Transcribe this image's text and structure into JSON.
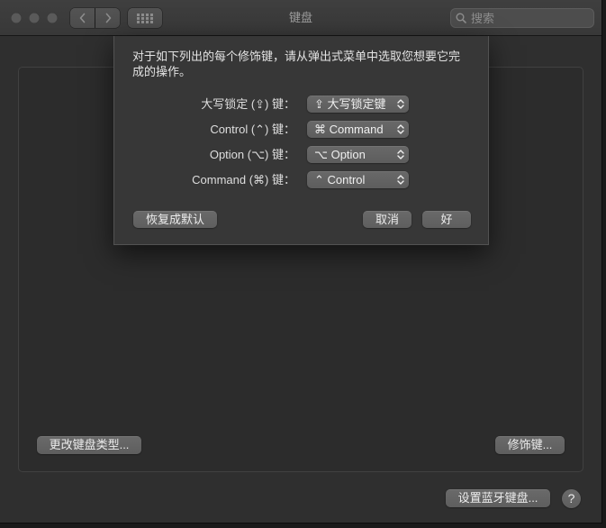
{
  "window": {
    "title": "键盘",
    "search_placeholder": "搜索"
  },
  "sheet": {
    "prompt": "对于如下列出的每个修饰键，请从弹出式菜单中选取您想要它完成的操作。",
    "rows": [
      {
        "label": "大写锁定 (⇪) 键：",
        "value": "⇪ 大写锁定键"
      },
      {
        "label": "Control (⌃) 键：",
        "value": "⌘ Command"
      },
      {
        "label": "Option (⌥) 键：",
        "value": "⌥ Option"
      },
      {
        "label": "Command (⌘) 键：",
        "value": "⌃ Control"
      }
    ],
    "restore_defaults_label": "恢复成默认",
    "cancel_label": "取消",
    "ok_label": "好"
  },
  "panel": {
    "change_keyboard_type_label": "更改键盘类型...",
    "modifier_keys_label": "修饰键..."
  },
  "footer": {
    "bluetooth_keyboard_label": "设置蓝牙键盘...",
    "help_label": "?"
  },
  "icons": {
    "back": "chevron-left-icon",
    "forward": "chevron-right-icon",
    "show_all": "grid-icon",
    "search": "search-icon",
    "popup": "up-down-chevron-icon"
  }
}
